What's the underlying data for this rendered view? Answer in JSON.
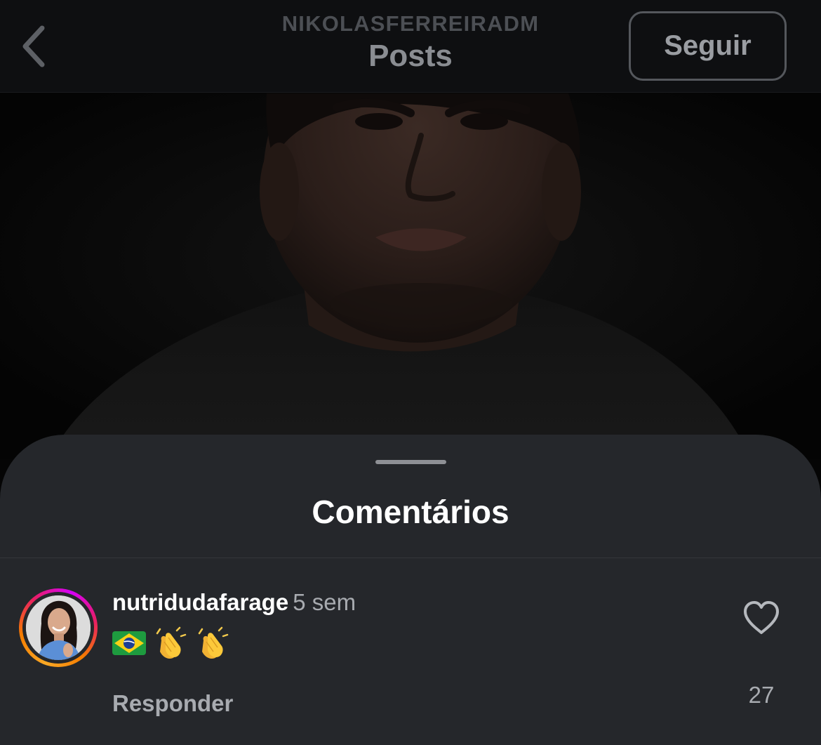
{
  "header": {
    "username": "NIKOLASFERREIRADM",
    "title": "Posts",
    "follow_label": "Seguir",
    "back_icon": "chevron-left-icon"
  },
  "comments_sheet": {
    "title": "Comentários",
    "comments": [
      {
        "username": "nutridudafarage",
        "time": "5 sem",
        "emojis": [
          "brazil-flag-emoji",
          "clapping-hands-emoji",
          "clapping-hands-emoji"
        ],
        "reply_label": "Responder",
        "like_icon": "heart-outline-icon",
        "like_count": "27"
      }
    ]
  },
  "colors": {
    "header_bg": "#0e0f11",
    "sheet_bg": "#25272b",
    "primary_text": "#ffffff",
    "secondary_text": "#a8abb0",
    "story_ring": [
      "#f9a825",
      "#e91e63",
      "#d500f9"
    ]
  }
}
